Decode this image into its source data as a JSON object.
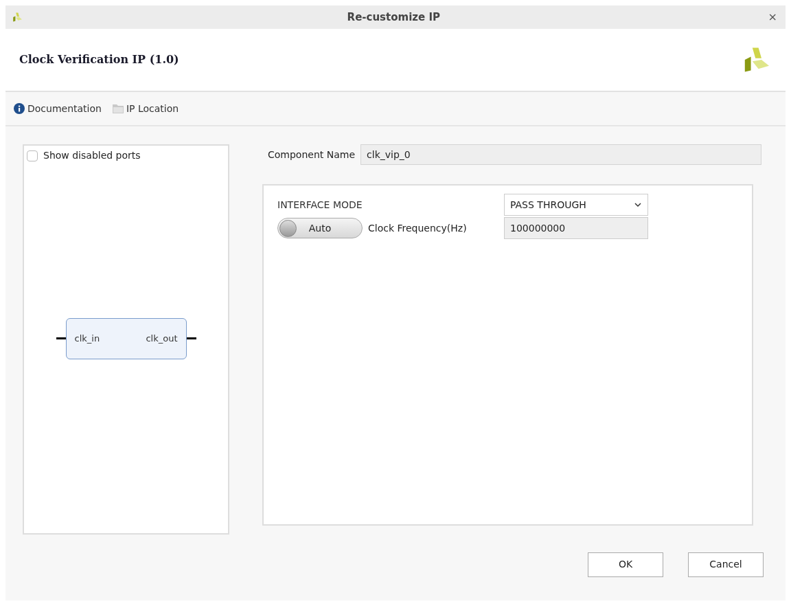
{
  "window": {
    "title": "Re-customize IP",
    "close": "×"
  },
  "header": {
    "title": "Clock Verification IP (1.0)"
  },
  "toolbar": [
    {
      "kind": "info",
      "label": "Documentation"
    },
    {
      "kind": "folder",
      "label": "IP Location"
    }
  ],
  "ports_panel": {
    "show_disabled": {
      "label": "Show disabled ports",
      "checked": false
    },
    "block": {
      "input": "clk_in",
      "output": "clk_out"
    }
  },
  "component_name": {
    "label": "Component Name",
    "value": "clk_vip_0"
  },
  "settings": {
    "interface_mode": {
      "label": "INTERFACE MODE",
      "value": "PASS THROUGH"
    },
    "clock_frequency": {
      "toggle": {
        "label": "Auto",
        "on": false
      },
      "label": "Clock Frequency(Hz)",
      "value": "100000000"
    }
  },
  "buttons": [
    "OK",
    "Cancel"
  ]
}
